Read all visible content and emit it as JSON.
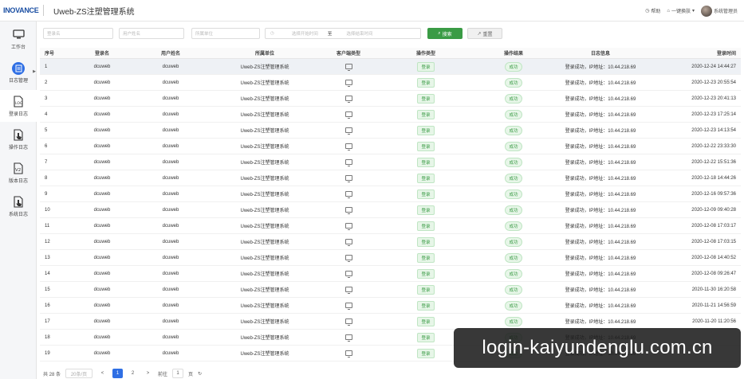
{
  "header": {
    "logo": "INOVANCE",
    "app_title": "Uweb-ZS注塑管理系统",
    "help_label": "帮助",
    "quick_label": "一键换肤",
    "user_name": "系统管理员"
  },
  "sidebar": {
    "items": [
      {
        "label": "工作台",
        "icon": "monitor-icon"
      },
      {
        "label": "日志管理",
        "icon": "document-icon"
      },
      {
        "label": "登录日志",
        "icon": "log-icon"
      },
      {
        "label": "操作日志",
        "icon": "pointer-icon"
      },
      {
        "label": "版本日志",
        "icon": "version-icon"
      },
      {
        "label": "系统日志",
        "icon": "pointer-icon"
      }
    ]
  },
  "filters": {
    "login_name_placeholder": "登录名",
    "user_name_placeholder": "用户姓名",
    "unit_placeholder": "所属单位",
    "start_placeholder": "选择开始时间",
    "range_sep": "至",
    "end_placeholder": "选择结束时间",
    "search_label": "搜索",
    "reset_label": "重置"
  },
  "table": {
    "columns": [
      "序号",
      "登录名",
      "用户姓名",
      "所属单位",
      "客户端类型",
      "操作类型",
      "操作结果",
      "日志信息",
      "登录时间"
    ],
    "rows": [
      {
        "no": "1",
        "login": "dcuweb",
        "user": "dcuweb",
        "unit": "Uweb-ZS注塑管理系统",
        "op": "登录",
        "res": "成功",
        "info": "登录成功，IP地址：10.44.218.69",
        "time": "2020-12-24 14:44:27"
      },
      {
        "no": "2",
        "login": "dcuweb",
        "user": "dcuweb",
        "unit": "Uweb-ZS注塑管理系统",
        "op": "登录",
        "res": "成功",
        "info": "登录成功，IP地址：10.44.218.69",
        "time": "2020-12-23 20:55:54"
      },
      {
        "no": "3",
        "login": "dcuweb",
        "user": "dcuweb",
        "unit": "Uweb-ZS注塑管理系统",
        "op": "登录",
        "res": "成功",
        "info": "登录成功，IP地址：10.44.218.69",
        "time": "2020-12-23 20:41:13"
      },
      {
        "no": "4",
        "login": "dcuweb",
        "user": "dcuweb",
        "unit": "Uweb-ZS注塑管理系统",
        "op": "登录",
        "res": "成功",
        "info": "登录成功，IP地址：10.44.218.69",
        "time": "2020-12-23 17:25:14"
      },
      {
        "no": "5",
        "login": "dcuweb",
        "user": "dcuweb",
        "unit": "Uweb-ZS注塑管理系统",
        "op": "登录",
        "res": "成功",
        "info": "登录成功，IP地址：10.44.218.69",
        "time": "2020-12-23 14:13:54"
      },
      {
        "no": "6",
        "login": "dcuweb",
        "user": "dcuweb",
        "unit": "Uweb-ZS注塑管理系统",
        "op": "登录",
        "res": "成功",
        "info": "登录成功，IP地址：10.44.218.69",
        "time": "2020-12-22 23:33:30"
      },
      {
        "no": "7",
        "login": "dcuweb",
        "user": "dcuweb",
        "unit": "Uweb-ZS注塑管理系统",
        "op": "登录",
        "res": "成功",
        "info": "登录成功，IP地址：10.44.218.69",
        "time": "2020-12-22 15:51:36"
      },
      {
        "no": "8",
        "login": "dcuweb",
        "user": "dcuweb",
        "unit": "Uweb-ZS注塑管理系统",
        "op": "登录",
        "res": "成功",
        "info": "登录成功，IP地址：10.44.218.69",
        "time": "2020-12-18 14:44:26"
      },
      {
        "no": "9",
        "login": "dcuweb",
        "user": "dcuweb",
        "unit": "Uweb-ZS注塑管理系统",
        "op": "登录",
        "res": "成功",
        "info": "登录成功，IP地址：10.44.218.69",
        "time": "2020-12-16 09:57:36"
      },
      {
        "no": "10",
        "login": "dcuweb",
        "user": "dcuweb",
        "unit": "Uweb-ZS注塑管理系统",
        "op": "登录",
        "res": "成功",
        "info": "登录成功，IP地址：10.44.218.69",
        "time": "2020-12-09 09:40:28"
      },
      {
        "no": "11",
        "login": "dcuweb",
        "user": "dcuweb",
        "unit": "Uweb-ZS注塑管理系统",
        "op": "登录",
        "res": "成功",
        "info": "登录成功，IP地址：10.44.218.69",
        "time": "2020-12-08 17:03:17"
      },
      {
        "no": "12",
        "login": "dcuweb",
        "user": "dcuweb",
        "unit": "Uweb-ZS注塑管理系统",
        "op": "登录",
        "res": "成功",
        "info": "登录成功，IP地址：10.44.218.69",
        "time": "2020-12-08 17:03:15"
      },
      {
        "no": "13",
        "login": "dcuweb",
        "user": "dcuweb",
        "unit": "Uweb-ZS注塑管理系统",
        "op": "登录",
        "res": "成功",
        "info": "登录成功，IP地址：10.44.218.69",
        "time": "2020-12-08 14:40:52"
      },
      {
        "no": "14",
        "login": "dcuweb",
        "user": "dcuweb",
        "unit": "Uweb-ZS注塑管理系统",
        "op": "登录",
        "res": "成功",
        "info": "登录成功，IP地址：10.44.218.69",
        "time": "2020-12-08 09:26:47"
      },
      {
        "no": "15",
        "login": "dcuweb",
        "user": "dcuweb",
        "unit": "Uweb-ZS注塑管理系统",
        "op": "登录",
        "res": "成功",
        "info": "登录成功，IP地址：10.44.218.69",
        "time": "2020-11-30 16:20:58"
      },
      {
        "no": "16",
        "login": "dcuweb",
        "user": "dcuweb",
        "unit": "Uweb-ZS注塑管理系统",
        "op": "登录",
        "res": "成功",
        "info": "登录成功，IP地址：10.44.218.69",
        "time": "2020-11-21 14:56:59"
      },
      {
        "no": "17",
        "login": "dcuweb",
        "user": "dcuweb",
        "unit": "Uweb-ZS注塑管理系统",
        "op": "登录",
        "res": "成功",
        "info": "登录成功，IP地址：10.44.218.69",
        "time": "2020-11-20 11:20:56"
      },
      {
        "no": "18",
        "login": "dcuweb",
        "user": "dcuweb",
        "unit": "Uweb-ZS注塑管理系统",
        "op": "登录",
        "res": "成功",
        "info": "登录成功，IP地址：10.44.218.69",
        "time": ""
      },
      {
        "no": "19",
        "login": "dcuweb",
        "user": "dcuweb",
        "unit": "Uweb-ZS注塑管理系统",
        "op": "登录",
        "res": "成功",
        "info": "登录成功，IP地址：10.44.218.69",
        "time": ""
      }
    ]
  },
  "pager": {
    "total": "共 28 条",
    "page_size": "20条/页",
    "prev": "<",
    "page1": "1",
    "page2": "2",
    "next": ">",
    "goto": "前往",
    "goto_value": "1",
    "page_unit": "页"
  },
  "watermark": "login-kaiyundenglu.com.cn",
  "colors": {
    "primary": "#2f6fe4",
    "success": "#3a9b45",
    "logo": "#1b4fa3"
  }
}
